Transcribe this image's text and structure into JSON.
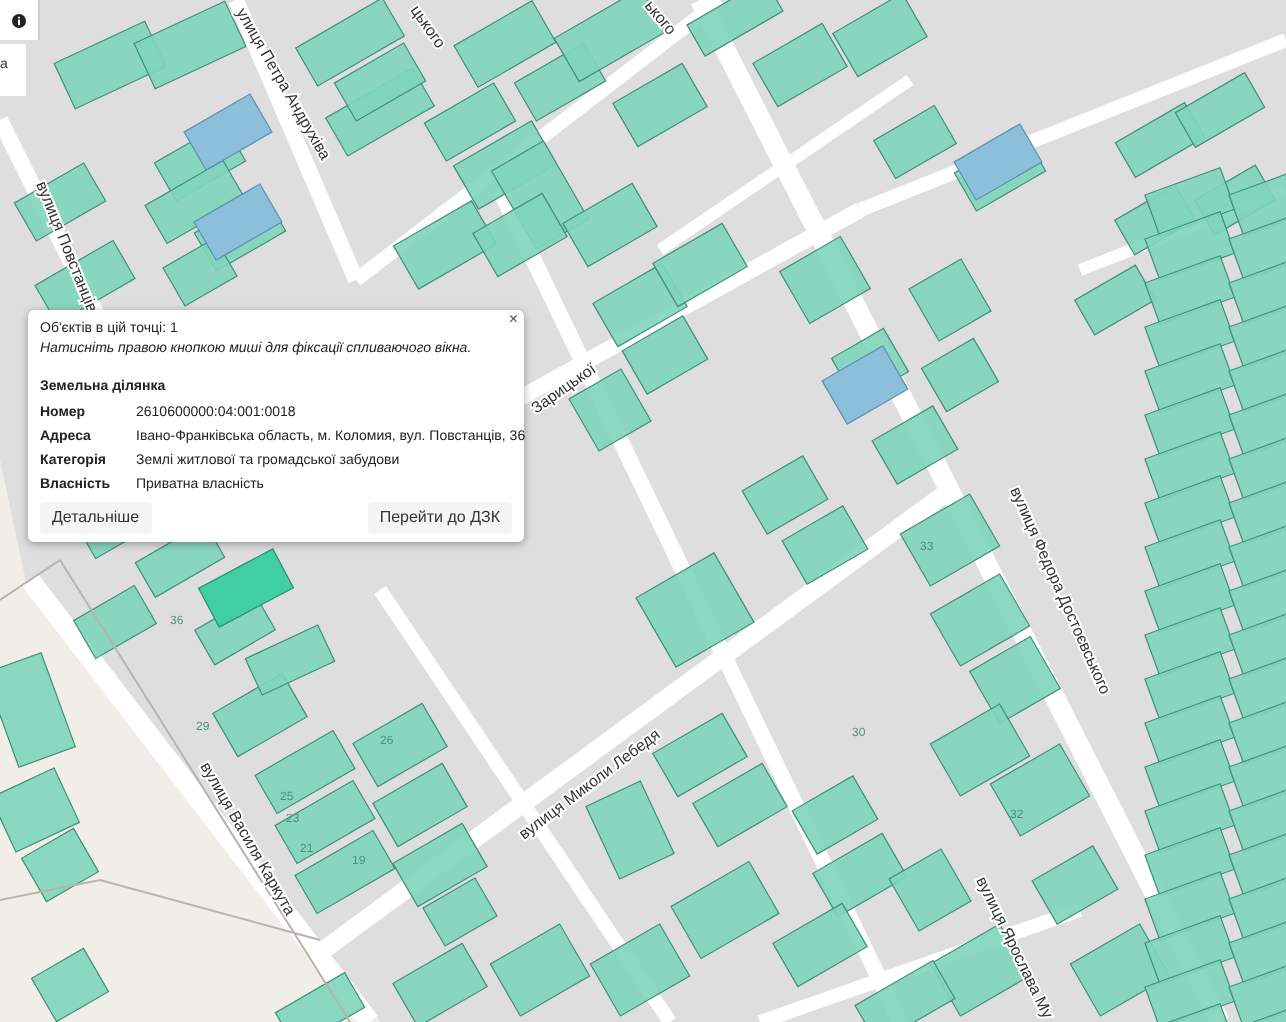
{
  "map_controls": {
    "legend_panel_text": "а"
  },
  "street_labels": [
    "улиця Петра Андрухіва",
    "вулиця Повстанців",
    "цького",
    "ького",
    "Зарицької",
    "вулиця Миколи Лебедя",
    "вулиця Федора Достоєвського",
    "вулиця Василя Каркута",
    "вулиця Ярослава Му"
  ],
  "house_numbers": [
    "36",
    "29",
    "26",
    "25",
    "23",
    "21",
    "19",
    "33",
    "32",
    "30"
  ],
  "popup": {
    "objects_count": "Об'єктів в цій точці: 1",
    "hint": "Натисніть правою кнопкою миші для фіксації спливаючого вікна.",
    "close": "×",
    "section_title": "Земельна ділянка",
    "fields": [
      {
        "label": "Номер",
        "value": "2610600000:04:001:0018"
      },
      {
        "label": "Адреса",
        "value": "Івано-Франківська область, м. Коломия, вул. Повстанців, 36"
      },
      {
        "label": "Категорія",
        "value": "Землі житлової та громадської забудови"
      },
      {
        "label": "Власність",
        "value": "Приватна власність"
      }
    ],
    "buttons": [
      "Детальніше",
      "Перейти до ДЗК"
    ]
  }
}
